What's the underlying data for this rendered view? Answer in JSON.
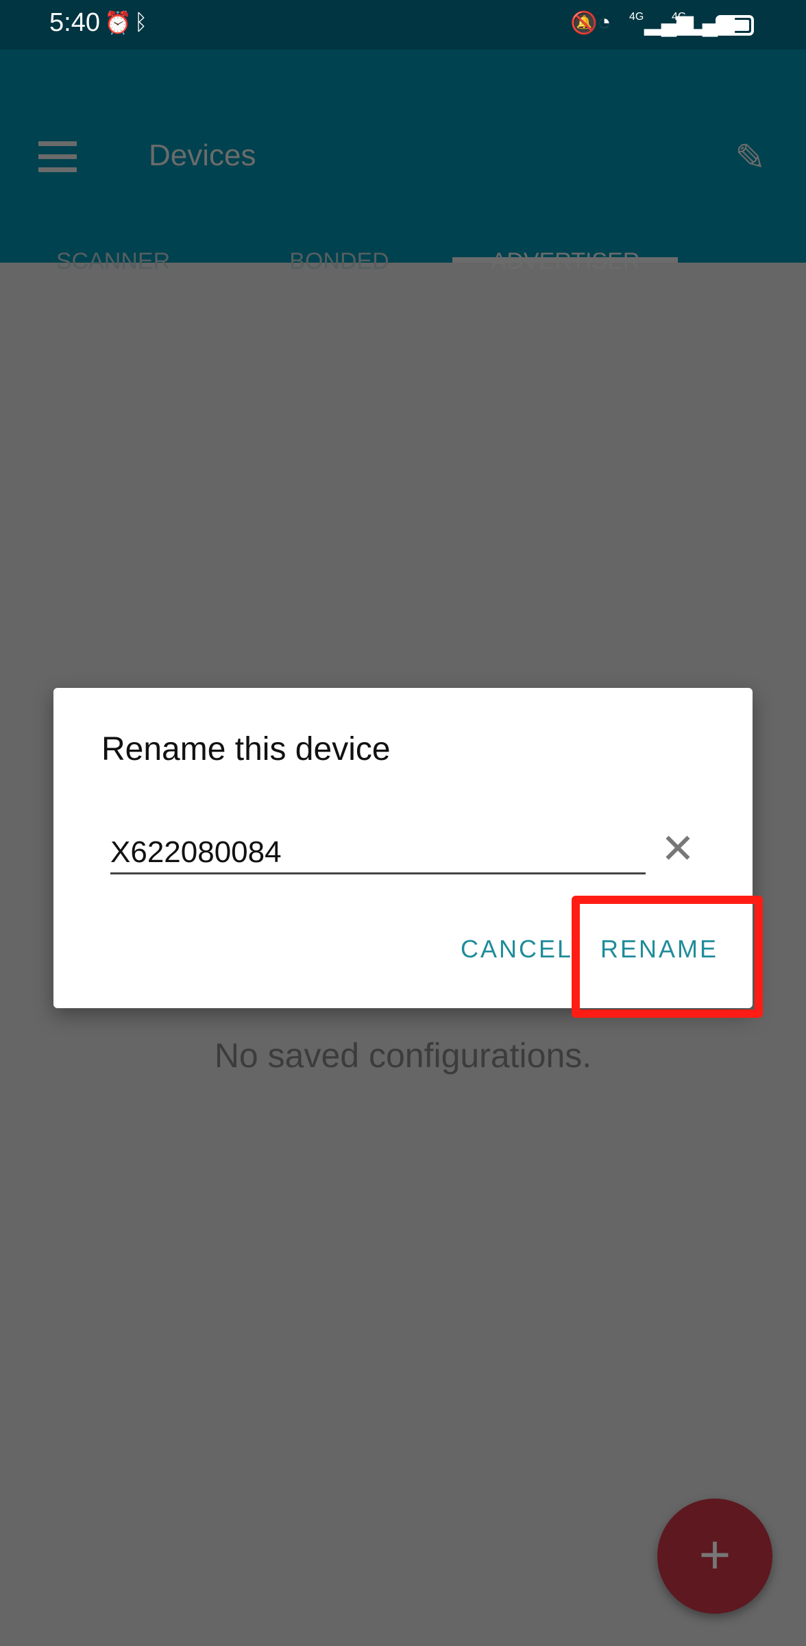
{
  "status_bar": {
    "time": "5:40",
    "left_icons": [
      "alarm-icon",
      "bluetooth-icon"
    ],
    "right_icons": [
      "mute-icon",
      "wifi-icon",
      "signal-4g-icon",
      "signal-4g-icon",
      "battery-icon"
    ],
    "network_label": "4G"
  },
  "app_bar": {
    "title": "Devices",
    "menu_icon": "hamburger-icon",
    "action_icon": "pencil-icon"
  },
  "tabs": [
    {
      "label": "SCANNER",
      "active": false
    },
    {
      "label": "BONDED",
      "active": false
    },
    {
      "label": "ADVERTISER",
      "active": true
    }
  ],
  "main": {
    "empty_message": "No saved configurations."
  },
  "dialog": {
    "title": "Rename this device",
    "input_value": "X622080084",
    "clear_icon": "close-icon",
    "cancel_label": "CANCEL",
    "rename_label": "RENAME"
  },
  "fab": {
    "icon": "plus-icon",
    "label": "+"
  },
  "colors": {
    "app_bar": "#00424f",
    "accent": "#1f8c99",
    "fab": "#5e1820",
    "highlight": "#ff1c14"
  }
}
